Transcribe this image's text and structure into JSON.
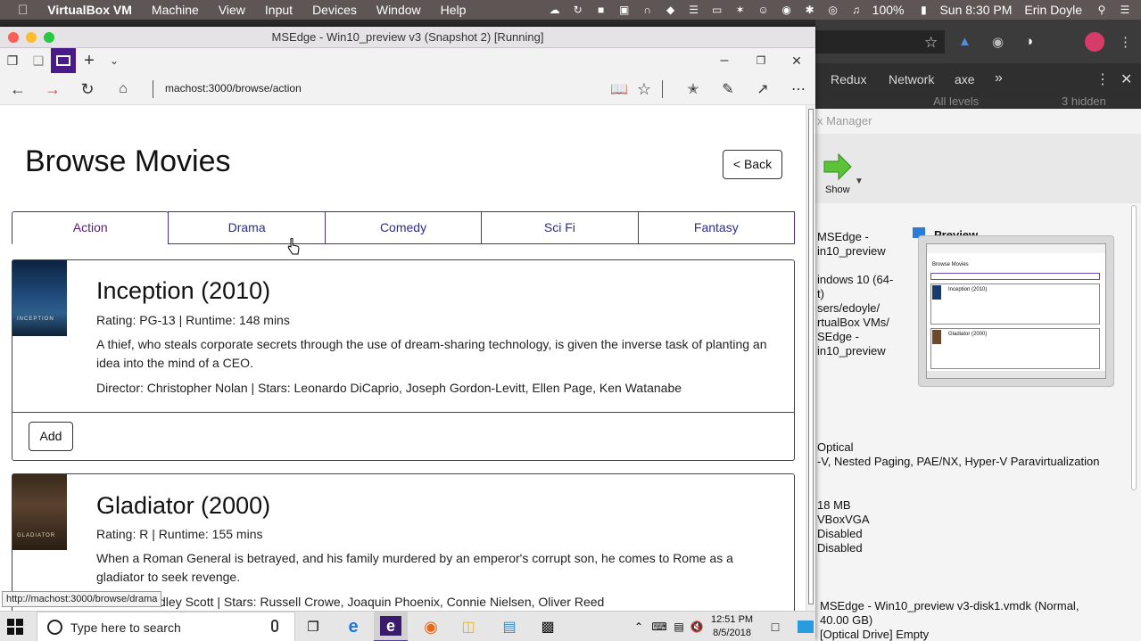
{
  "mac_menu": {
    "app_name": "VirtualBox VM",
    "items": [
      "Machine",
      "View",
      "Input",
      "Devices",
      "Window",
      "Help"
    ],
    "battery": "100%",
    "clock": "Sun 8:30 PM",
    "user": "Erin Doyle"
  },
  "vm_window": {
    "title": "MSEdge - Win10_preview v3 (Snapshot 2) [Running]"
  },
  "browser": {
    "url": "machost:3000/browse/action",
    "status_url": "http://machost:3000/browse/drama"
  },
  "page": {
    "title": "Browse Movies",
    "back_label": "< Back",
    "genre_tabs": [
      "Action",
      "Drama",
      "Comedy",
      "Sci Fi",
      "Fantasy"
    ],
    "active_tab": "Action",
    "movies": [
      {
        "title": "Inception (2010)",
        "poster_text": "INCEPTION",
        "meta": "Rating: PG-13 | Runtime: 148 mins",
        "description": "A thief, who steals corporate secrets through the use of dream-sharing technology, is given the inverse task of planting an idea into the mind of a CEO.",
        "crew": "Director: Christopher Nolan | Stars: Leonardo DiCaprio, Joseph Gordon-Levitt, Ellen Page, Ken Watanabe",
        "add_label": "Add"
      },
      {
        "title": "Gladiator (2000)",
        "poster_text": "GLADIATOR",
        "meta": "Rating: R | Runtime: 155 mins",
        "description": "When a Roman General is betrayed, and his family murdered by an emperor's corrupt son, he comes to Rome as a gladiator to seek revenge.",
        "crew": "Director: Ridley Scott | Stars: Russell Crowe, Joaquin Phoenix, Connie Nielsen, Oliver Reed"
      }
    ]
  },
  "taskbar": {
    "search_placeholder": "Type here to search",
    "time": "12:51 PM",
    "date": "8/5/2018"
  },
  "host_app": {
    "devtools_tabs": [
      "Redux",
      "Network",
      "axe"
    ],
    "levels_label": "All levels",
    "hidden_label": "3 hidden",
    "manager_title": "x Manager",
    "show_label": "Show",
    "preview_label": "Preview",
    "details": [
      "MSEdge -",
      "in10_preview",
      "indows 10 (64-",
      "t)",
      "sers/edoyle/",
      "rtualBox VMs/",
      "SEdge -",
      "in10_preview",
      "Optical",
      "-V, Nested Paging, PAE/NX, Hyper-V Paravirtualization",
      "18 MB",
      "VBoxVGA",
      "Disabled",
      "Disabled",
      "MSEdge - Win10_preview v3-disk1.vmdk (Normal,",
      "40.00 GB)",
      "[Optical Drive] Empty"
    ],
    "preview_mini": {
      "title": "Browse Movies",
      "movie1": "Inception (2010)",
      "movie2": "Gladiator (2000)"
    }
  },
  "colors": {
    "mac_bar": "#5e5555",
    "tab_border": "#4a2d8a",
    "taskbar_accent": "#5a3fa0"
  }
}
